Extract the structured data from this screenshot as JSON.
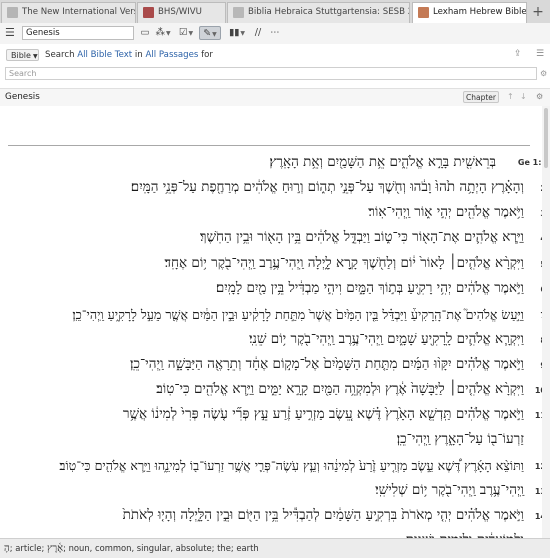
{
  "tabs": [
    {
      "label": "The New International Version",
      "icon_color": "#b5b5b5",
      "active": false
    },
    {
      "label": "BHS/WIVU",
      "icon_color": "#a94a4a",
      "active": false
    },
    {
      "label": "Biblia Hebraica Stuttgartensia: SESB 2.0 Version",
      "icon_color": "#b8b8b8",
      "active": false
    },
    {
      "label": "Lexham Hebrew Bible",
      "icon_color": "#c47a55",
      "active": true
    }
  ],
  "tab_close_glyph": "×",
  "new_tab_glyph": "+",
  "toolbar": {
    "reference_value": "Genesis",
    "icons": [
      "book-icon",
      "visual-filter-icon",
      "check-icon",
      "highlight-icon",
      "columns-icon",
      "parallel-icon",
      "more-icon"
    ]
  },
  "search": {
    "resource_button": "Bible",
    "prefix": "Search",
    "scope": "All Bible Text",
    "middle": "in",
    "range": "All Passages",
    "suffix": "for",
    "placeholder": "Search"
  },
  "nav": {
    "title": "Genesis",
    "chapter_button": "Chapter"
  },
  "verses": [
    {
      "num": "Ge 1:1",
      "text": "בְּרֵאשִׁ֖ית בָּרָ֣א אֱלֹהִ֑ים אֵ֥ת הַשָּׁמַ֖יִם וְאֵ֥ת הָאָֽרֶץ׃"
    },
    {
      "num": "2",
      "text": "וְהָאָ֗רֶץ הָיְתָ֥ה תֹ֙הוּ֙ וָבֹ֔הוּ וְחֹ֖שֶׁךְ עַל־פְּנֵ֣י תְה֑וֹם וְר֣וּחַ אֱלֹהִ֔ים מְרַחֶ֖פֶת עַל־פְּנֵ֥י הַמָּֽיִם׃"
    },
    {
      "num": "3",
      "text": "וַיֹּ֥אמֶר אֱלֹהִ֖ים יְהִ֣י א֑וֹר וַֽיְהִי־אֽוֹר׃"
    },
    {
      "num": "4",
      "text": "וַיַּ֧רְא אֱלֹהִ֛ים אֶת־הָא֖וֹר כִּי־ט֑וֹב וַיַּבְדֵּ֣ל אֱלֹהִ֔ים בֵּ֥ין הָא֖וֹר וּבֵ֥ין הַחֹֽשֶׁךְ׃"
    },
    {
      "num": "5",
      "text": "וַיִּקְרָ֨א אֱלֹהִ֤ים׀ לָאוֹר֙ י֔וֹם וְלַחֹ֖שֶׁךְ קָ֣רָא לָ֑יְלָה וַֽיְהִי־עֶ֥רֶב וַֽיְהִי־בֹ֖קֶר י֥וֹם אֶחָֽד׃"
    },
    {
      "num": "6",
      "text": "וַיֹּ֣אמֶר אֱלֹהִ֔ים יְהִ֥י רָקִ֖יעַ בְּת֣וֹךְ הַמָּ֑יִם וִיהִ֣י מַבְדִּ֔יל בֵּ֥ין מַ֖יִם לָמָֽיִם׃"
    },
    {
      "num": "7",
      "text": "וַיַּ֣עַשׂ אֱלֹהִים֮ אֶת־הָֽרָקִיעַ֒ וַיַּבְדֵּ֗ל בֵּ֤ין הַמַּ֙יִם֙ אֲשֶׁר֙ מִתַּ֣חַת לָרָקִ֔יעַ וּבֵ֣ין הַמַּ֔יִם אֲשֶׁ֖ר מֵעַ֣ל לָרָקִ֑יעַ וַֽיְהִי־כֵֽן׃"
    },
    {
      "num": "8",
      "text": "וַיִּקְרָ֧א אֱלֹהִ֛ים לָֽרָקִ֖יעַ שָׁמָ֑יִם וַֽיְהִי־עֶ֥רֶב וַֽיְהִי־בֹ֖קֶר י֥וֹם שֵׁנִֽי׃"
    },
    {
      "num": "9",
      "text": "וַיֹּ֣אמֶר אֱלֹהִ֗ים יִקָּו֨וּ הַמַּ֜יִם מִתַּ֤חַת הַשָּׁמַ֙יִם֙ אֶל־מָק֣וֹם אֶחָ֔ד וְתֵרָאֶ֖ה הַיַּבָּשָׁ֑ה וַֽיְהִי־כֵֽן׃"
    },
    {
      "num": "10",
      "text": "וַיִּקְרָ֨א אֱלֹהִ֤ים׀ לַיַּבָּשָׁה֙ אֶ֔רֶץ וּלְמִקְוֵ֥ה הַמַּ֖יִם קָרָ֣א יַמִּ֑ים וַיַּ֥רְא אֱלֹהִ֖ים כִּי־טֽוֹב׃"
    },
    {
      "num": "11",
      "text": "וַיֹּ֣אמֶר אֱלֹהִ֗ים תַּֽדְשֵׁ֤א הָאָ֙רֶץ֙ דֶּ֗שֶׁא עֵ֚שֶׂב מַזְרִ֣יעַ זֶ֔רַע עֵ֣ץ פְּרִ֞י עֹ֤שֶׂה פְּרִי֙ לְמִינ֔וֹ אֲשֶׁ֥ר זַרְעוֹ־ב֖וֹ עַל־הָאָ֑רֶץ וַֽיְהִי־כֵֽן׃",
      "wrap": true
    },
    {
      "num": "12",
      "text": "וַתּוֹצֵ֨א הָאָ֜רֶץ דֶּ֠שֶׁא עֵ֣שֶׂב מַזְרִ֤יעַ זֶ֙רַע֙ לְמִינֵ֔הוּ וְעֵ֧ץ עֹֽשֶׂה־פְּרִ֛י אֲשֶׁ֥ר זַרְעוֹ־ב֖וֹ לְמִינֵ֑הוּ וַיַּ֥רְא אֱלֹהִ֖ים כִּי־טֽוֹב׃"
    },
    {
      "num": "13",
      "text": "וַֽיְהִי־עֶ֥רֶב וַֽיְהִי־בֹ֖קֶר י֥וֹם שְׁלִישִֽׁי׃"
    },
    {
      "num": "14",
      "text": "וַיֹּ֣אמֶר אֱלֹהִ֗ים יְהִ֤י מְאֹרֹת֙ בִּרְקִ֣יעַ הַשָּׁמַ֔יִם לְהַבְדִּ֕יל בֵּ֥ין הַיּ֖וֹם וּבֵ֣ין הַלָּ֑יְלָה וְהָי֤וּ לְאֹתֹת֙ וּלְמ֣וֹעֲדִ֔ים וּלְיָמִ֖ים וְשָׁנִֽים׃",
      "wrap": true
    }
  ],
  "status": {
    "prefix_hebrew": "הָ",
    "prefix_desc": "; article; ",
    "word_hebrew": "אֶ֫רֶץ",
    "word_desc": "; noun, common, singular, absolute; the; earth"
  },
  "colors": {
    "link": "#2c62a8",
    "active_tab": "#ffffff"
  }
}
